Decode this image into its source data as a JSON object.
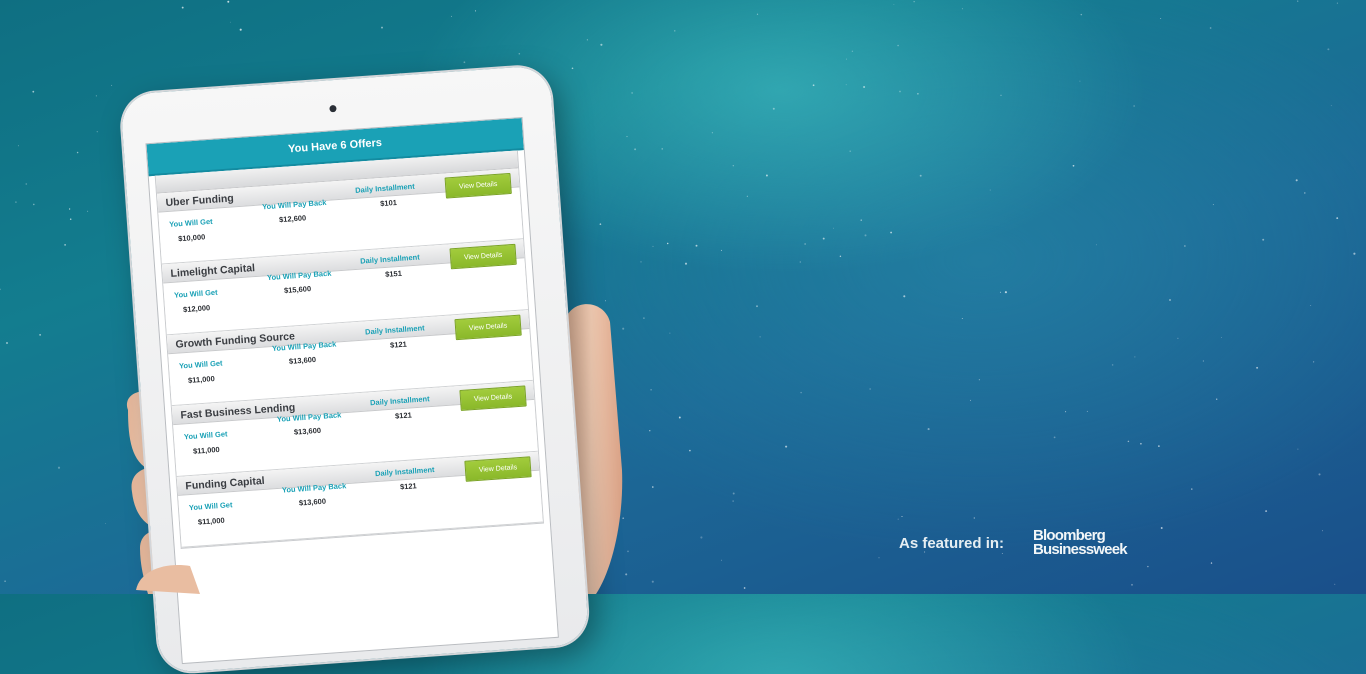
{
  "offers_header": "You Have 6 Offers",
  "column_labels": {
    "get": "You Will Get",
    "pay": "You Will Pay Back",
    "daily": "Daily Installment"
  },
  "button_label": "View Details",
  "offers": [
    {
      "lender": "Uber Funding",
      "get": "$10,000",
      "pay": "$12,600",
      "daily": "$101"
    },
    {
      "lender": "Limelight Capital",
      "get": "$12,000",
      "pay": "$15,600",
      "daily": "$151"
    },
    {
      "lender": "Growth Funding Source",
      "get": "$11,000",
      "pay": "$13,600",
      "daily": "$121"
    },
    {
      "lender": "Fast Business Lending",
      "get": "$11,000",
      "pay": "$13,600",
      "daily": "$121"
    },
    {
      "lender": "Funding Capital",
      "get": "$11,000",
      "pay": "$13,600",
      "daily": "$121"
    }
  ],
  "featured": {
    "label": "As featured in:",
    "logo_line1": "Bloomberg",
    "logo_line2": "Businessweek"
  },
  "colors": {
    "accent_teal": "#1aa1b6",
    "button_green": "#8ab82a"
  }
}
